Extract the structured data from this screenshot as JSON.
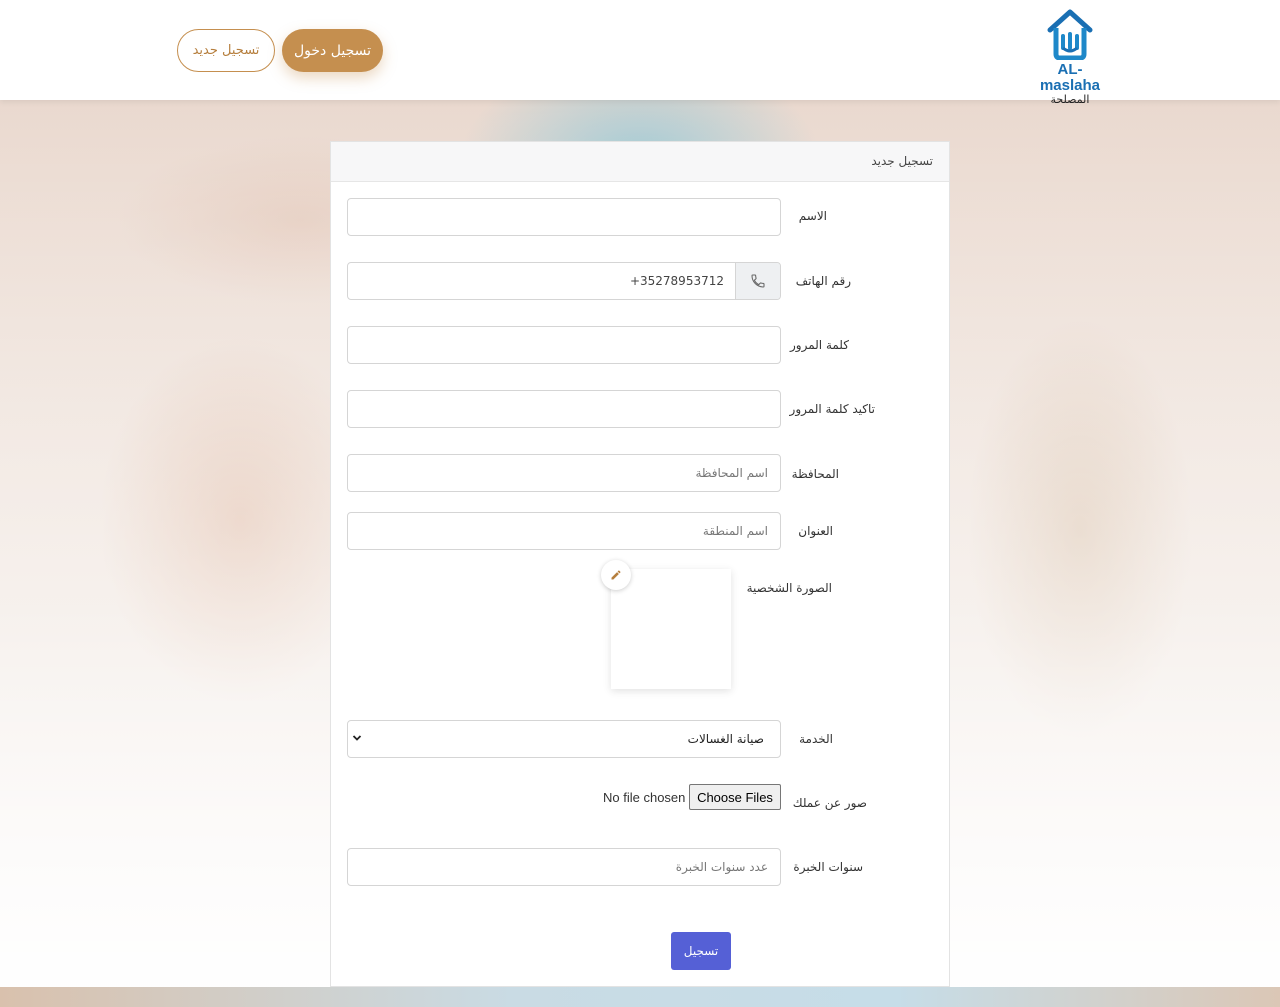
{
  "header": {
    "logo_text_en": "AL-maslaha",
    "logo_text_ar": "المصلحة",
    "login_label": "تسجيل دخول",
    "register_label": "تسجيل جديد"
  },
  "form": {
    "title": "تسجيل جديد",
    "fields": {
      "name": {
        "label": "الاسم",
        "value": ""
      },
      "phone": {
        "label": "رقم الهاتف",
        "value": "+35278953712"
      },
      "password": {
        "label": "كلمة المرور",
        "value": ""
      },
      "password_confirm": {
        "label": "تاكيد كلمة المرور",
        "value": ""
      },
      "governorate": {
        "label": "المحافظة",
        "placeholder": "اسم المحافظة"
      },
      "address": {
        "label": "العنوان",
        "placeholder": "اسم المنطقة"
      },
      "avatar": {
        "label": "الصورة الشخصية"
      },
      "service": {
        "label": "الخدمة",
        "selected": "صيانة الغسالات"
      },
      "work_photos": {
        "label": "صور عن عملك",
        "button": "Choose Files",
        "status": "No file chosen"
      },
      "experience": {
        "label": "سنوات الخبرة",
        "placeholder": "عدد سنوات الخبرة"
      }
    },
    "submit_label": "تسجيل"
  },
  "colors": {
    "brand_gold": "#c58f4f",
    "brand_blue": "#1a6fb3",
    "submit_blue": "#5560d6"
  },
  "icons": {
    "phone": "phone-icon",
    "edit": "pencil-icon",
    "select": "chevron-down-icon",
    "logo": "house-logo-icon"
  }
}
